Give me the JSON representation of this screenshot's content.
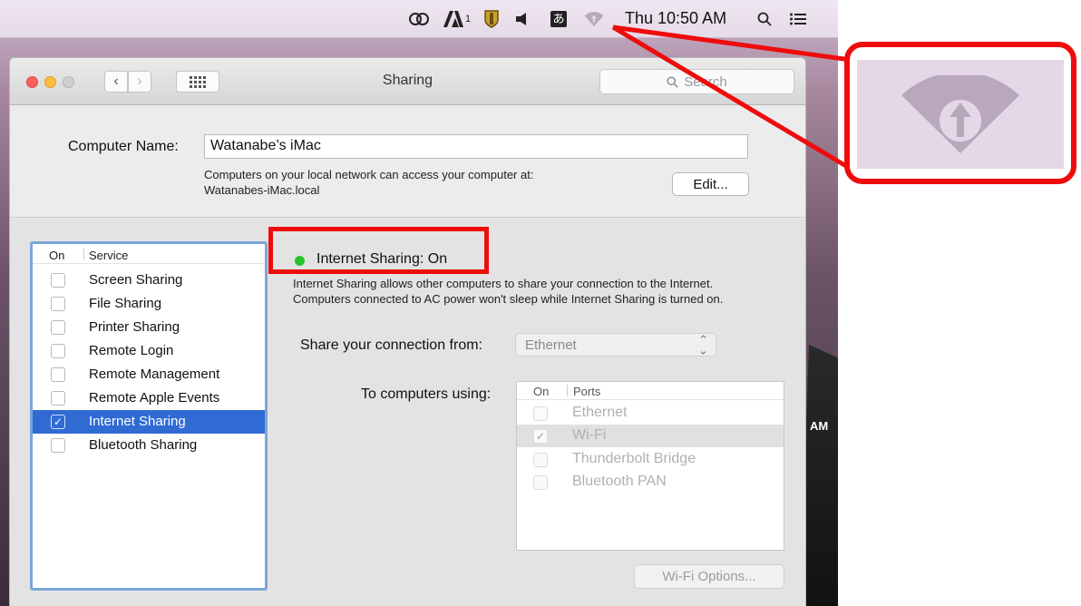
{
  "menubar": {
    "clock": "Thu 10:50 AM",
    "icons": [
      "creative-cloud-icon",
      "adobe-icon",
      "shield-icon",
      "volume-icon",
      "input-method-icon",
      "internet-sharing-icon",
      "spotlight-icon",
      "notification-center-icon"
    ],
    "input_method_glyph": "あ",
    "adobe_badge": "1"
  },
  "window": {
    "title": "Sharing",
    "search_placeholder": "Search",
    "computer_name_label": "Computer Name:",
    "computer_name_value": "Watanabe’s iMac",
    "computer_desc_line1": "Computers on your local network can access your computer at:",
    "computer_desc_line2": "Watanabes-iMac.local",
    "edit_button": "Edit..."
  },
  "services": {
    "header_on": "On",
    "header_service": "Service",
    "items": [
      {
        "label": "Screen Sharing",
        "checked": false
      },
      {
        "label": "File Sharing",
        "checked": false
      },
      {
        "label": "Printer Sharing",
        "checked": false
      },
      {
        "label": "Remote Login",
        "checked": false
      },
      {
        "label": "Remote Management",
        "checked": false
      },
      {
        "label": "Remote Apple Events",
        "checked": false
      },
      {
        "label": "Internet Sharing",
        "checked": true
      },
      {
        "label": "Bluetooth Sharing",
        "checked": false
      }
    ],
    "selected_index": 6
  },
  "detail": {
    "status_title": "Internet Sharing: On",
    "status_color": "#27c22a",
    "description": "Internet Sharing allows other computers to share your connection to the Internet. Computers connected to AC power won't sleep while Internet Sharing is turned on.",
    "share_from_label": "Share your connection from:",
    "share_from_value": "Ethernet",
    "to_computers_label": "To computers using:",
    "ports_header_on": "On",
    "ports_header_ports": "Ports",
    "ports": [
      {
        "label": "Ethernet",
        "checked": false
      },
      {
        "label": "Wi-Fi",
        "checked": true
      },
      {
        "label": "Thunderbolt Bridge",
        "checked": false
      },
      {
        "label": "Bluetooth PAN",
        "checked": false
      }
    ],
    "wifi_options_button": "Wi-Fi Options..."
  },
  "annotation": {
    "highlight_color": "#ee0c0c",
    "zoomed_icon": "internet-sharing-icon"
  },
  "desktop": {
    "partial_text": "AM"
  }
}
